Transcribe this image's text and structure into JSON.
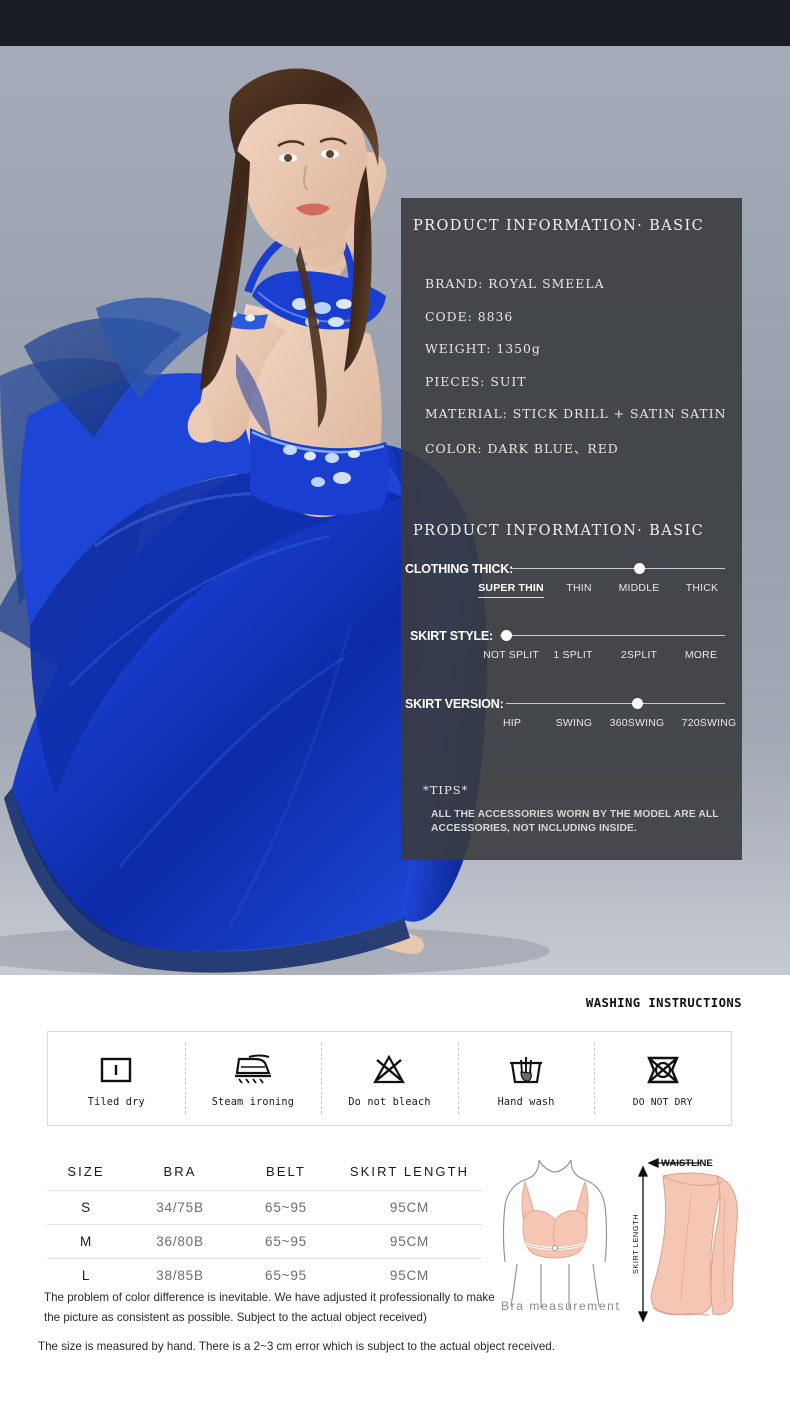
{
  "hero": {
    "alt": "belly dance costume model in royal blue satin skirt and jeweled bra",
    "background_color": "#9ba2b0",
    "costume_color": "#1a3fd0"
  },
  "panel": {
    "title_basic": "PRODUCT INFORMATION· BASIC",
    "title_spec": "PRODUCT INFORMATION· BASIC",
    "specs": [
      "BRAND: ROYAL SMEELA",
      "CODE:  8836",
      "WEIGHT: 1350g",
      "PIECES: SUIT",
      "MATERIAL: STICK DRILL + SATIN SATIN",
      "COLOR: DARK BLUE、RED"
    ],
    "sliders": [
      {
        "label": "CLOTHING THICK:",
        "ticks": [
          "SUPER THIN",
          "THIN",
          "MIDDLE",
          "THICK"
        ],
        "selected_index": 0,
        "dot_index": 2
      },
      {
        "label": "SKIRT STYLE:",
        "ticks": [
          "NOT SPLIT",
          "1 SPLIT",
          "2SPLIT",
          "MORE"
        ],
        "selected_index": -1,
        "dot_index": 0
      },
      {
        "label": "SKIRT VERSION:",
        "ticks": [
          "HIP",
          "SWING",
          "360SWING",
          "720SWING"
        ],
        "selected_index": -1,
        "dot_index": 2
      }
    ],
    "tips_title": "*TIPS*",
    "tips_body": "ALL THE ACCESSORIES WORN BY THE MODEL ARE ALL ACCESSORIES, NOT INCLUDING INSIDE."
  },
  "washing": {
    "title": "WASHING INSTRUCTIONS",
    "items": [
      {
        "icon": "tiled-dry-icon",
        "label": "Tiled dry"
      },
      {
        "icon": "steam-ironing-icon",
        "label": "Steam ironing"
      },
      {
        "icon": "do-not-bleach-icon",
        "label": "Do not bleach"
      },
      {
        "icon": "hand-wash-icon",
        "label": "Hand wash"
      },
      {
        "icon": "do-not-tumble-dry-icon",
        "label": "DO NOT DRY"
      }
    ]
  },
  "size_table": {
    "headers": [
      "SIZE",
      "BRA",
      "BELT",
      "SKIRT LENGTH"
    ],
    "rows": [
      [
        "S",
        "34/75B",
        "65~95",
        "95CM"
      ],
      [
        "M",
        "36/80B",
        "65~95",
        "95CM"
      ],
      [
        "L",
        "38/85B",
        "65~95",
        "95CM"
      ]
    ]
  },
  "notes": {
    "color_note": "The problem of color difference is inevitable. We have adjusted it professionally to make the picture as consistent as possible. Subject to the actual object received)",
    "size_note": "The size is measured by hand. There is a 2~3 cm error which is subject to the actual object received."
  },
  "diagrams": {
    "bra_caption": "Bra measurement",
    "waistline_label": "WAISTLINE",
    "skirt_length_label": "SKIRT LENGTH"
  }
}
